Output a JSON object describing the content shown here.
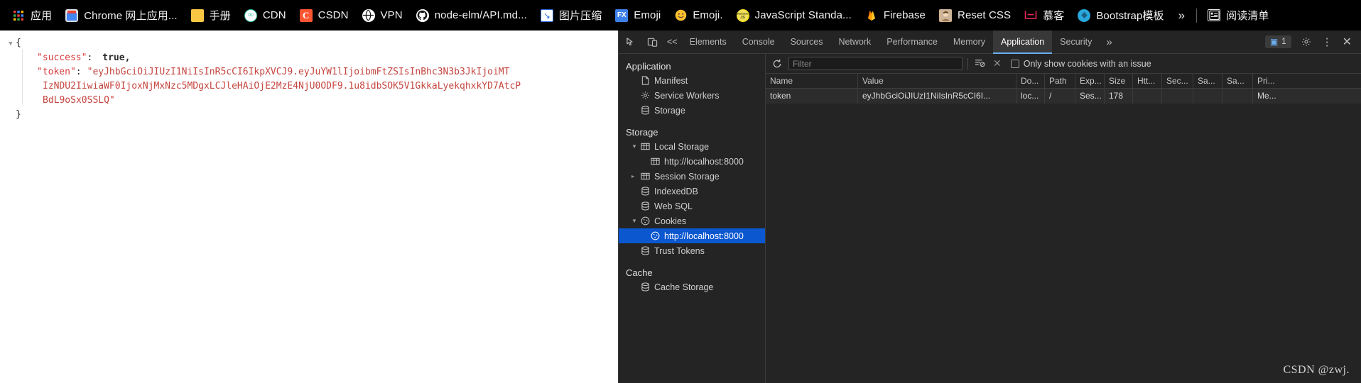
{
  "bookmarks": {
    "items": [
      {
        "label": "应用",
        "icon": "apps-grid-icon"
      },
      {
        "label": "Chrome 网上应用...",
        "icon": "chrome-web-store-icon"
      },
      {
        "label": "手册",
        "icon": "folder-icon"
      },
      {
        "label": "CDN",
        "icon": "cdn-icon"
      },
      {
        "label": "CSDN",
        "icon": "csdn-icon"
      },
      {
        "label": "VPN",
        "icon": "globe-icon"
      },
      {
        "label": "node-elm/API.md...",
        "icon": "github-icon"
      },
      {
        "label": "图片压缩",
        "icon": "image-compress-icon"
      },
      {
        "label": "Emoji",
        "icon": "fx-icon"
      },
      {
        "label": "Emoji.",
        "icon": "smiley-icon"
      },
      {
        "label": "JavaScript Standa...",
        "icon": "javascript-standard-icon"
      },
      {
        "label": "Firebase",
        "icon": "firebase-flame-icon"
      },
      {
        "label": "Reset CSS",
        "icon": "reset-css-icon"
      },
      {
        "label": "慕客",
        "icon": "imooc-icon"
      },
      {
        "label": "Bootstrap模板",
        "icon": "bootstrap-icon"
      }
    ],
    "overflow_label": "»",
    "reading_list": {
      "label": "阅读清单",
      "icon": "reading-list-icon"
    }
  },
  "json_viewer": {
    "collapse_arrow": "▼",
    "open_brace": "{",
    "close_brace": "}",
    "success_key": "\"success\"",
    "colon": ":",
    "success_value": "true,",
    "token_key": "\"token\"",
    "token_value_line1": "\"eyJhbGciOiJIUzI1NiIsInR5cCI6IkpXVCJ9.eyJuYW1lIjoibmFtZSIsInBhc3N3b3JkIjoiMT",
    "token_value_line2": "IzNDU2IiwiaWF0IjoxNjMxNzc5MDgxLCJleHAiOjE2MzE4NjU0ODF9.1u8idbSOK5V1GkkaLyekqhxkYD7AtcP",
    "token_value_line3": "BdL9oSx0SSLQ\""
  },
  "devtools": {
    "toolbar": {
      "inspect_icon": "inspect-element-icon",
      "device_icon": "device-toolbar-icon",
      "collapse_label": "<<",
      "tabs": [
        {
          "label": "Elements",
          "active": false
        },
        {
          "label": "Console",
          "active": false
        },
        {
          "label": "Sources",
          "active": false
        },
        {
          "label": "Network",
          "active": false
        },
        {
          "label": "Performance",
          "active": false
        },
        {
          "label": "Memory",
          "active": false
        },
        {
          "label": "Application",
          "active": true
        },
        {
          "label": "Security",
          "active": false
        }
      ],
      "more_tabs_label": "»",
      "message_count": "1",
      "message_icon": "chat-bubble-icon",
      "settings_icon": "gear-icon",
      "kebab_icon": "more-vertical-icon",
      "close_icon": "close-icon"
    },
    "sidebar": {
      "application_section": "Application",
      "application_items": [
        {
          "label": "Manifest",
          "icon": "manifest-icon"
        },
        {
          "label": "Service Workers",
          "icon": "gear-icon"
        },
        {
          "label": "Storage",
          "icon": "database-icon"
        }
      ],
      "storage_section": "Storage",
      "storage_items": [
        {
          "label": "Local Storage",
          "icon": "table-icon",
          "expanded": true,
          "level": 1
        },
        {
          "label": "http://localhost:8000",
          "icon": "table-icon",
          "expanded": null,
          "level": 2
        },
        {
          "label": "Session Storage",
          "icon": "table-icon",
          "expanded": false,
          "level": 1
        },
        {
          "label": "IndexedDB",
          "icon": "database-icon",
          "expanded": null,
          "level": 1
        },
        {
          "label": "Web SQL",
          "icon": "database-icon",
          "expanded": null,
          "level": 1
        },
        {
          "label": "Cookies",
          "icon": "cookie-icon",
          "expanded": true,
          "level": 1
        },
        {
          "label": "http://localhost:8000",
          "icon": "cookie-icon",
          "expanded": null,
          "level": 2,
          "selected": true
        },
        {
          "label": "Trust Tokens",
          "icon": "database-icon",
          "expanded": null,
          "level": 1
        }
      ],
      "cache_section": "Cache",
      "cache_items": [
        {
          "label": "Cache Storage",
          "icon": "database-icon"
        }
      ]
    },
    "filter_bar": {
      "refresh_icon": "refresh-icon",
      "filter_placeholder": "Filter",
      "clear_filtered_icon": "clear-filtered-icon",
      "clear_all_icon": "clear-all-icon",
      "only_issue_label": "Only show cookies with an issue",
      "only_issue_checked": false
    },
    "cookie_table": {
      "columns": [
        "Name",
        "Value",
        "Do...",
        "Path",
        "Exp...",
        "Size",
        "Htt...",
        "Sec...",
        "Sa...",
        "Sa...",
        "Pri..."
      ],
      "rows": [
        {
          "name": "token",
          "value": "eyJhbGciOiJIUzI1NiIsInR5cCI6I...",
          "domain": "loc...",
          "path": "/",
          "expires": "Ses...",
          "size": "178",
          "httponly": "",
          "secure": "",
          "samesite": "",
          "samepart": "",
          "priority": "Me..."
        }
      ]
    }
  },
  "watermark": "CSDN @zwj."
}
